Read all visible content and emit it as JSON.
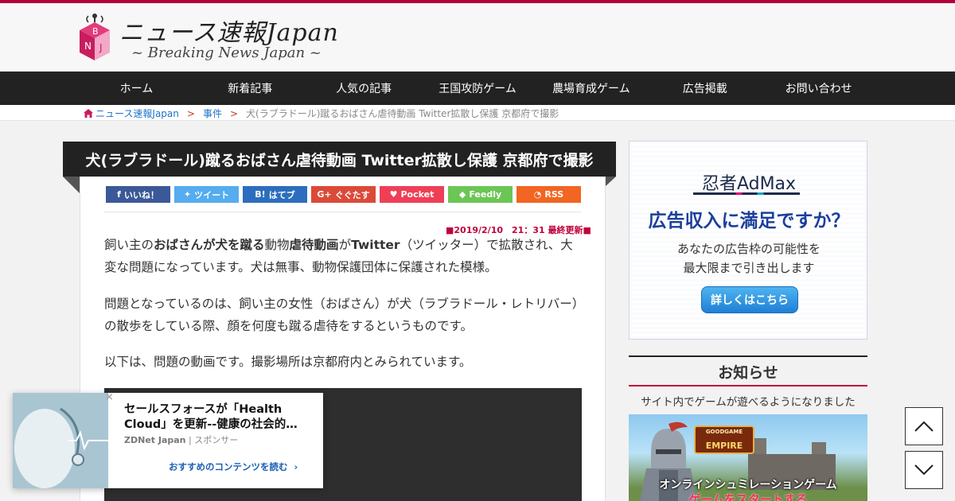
{
  "site": {
    "title": "ニュース速報Japan",
    "subtitle": "~ Breaking News Japan ~",
    "logo_letters": [
      "B",
      "N",
      "J"
    ],
    "brand_color": "#b3003b"
  },
  "nav": {
    "items": [
      {
        "label": "ホーム"
      },
      {
        "label": "新着記事"
      },
      {
        "label": "人気の記事"
      },
      {
        "label": "王国攻防ゲーム"
      },
      {
        "label": "農場育成ゲーム"
      },
      {
        "label": "広告掲載"
      },
      {
        "label": "お問い合わせ"
      }
    ]
  },
  "breadcrumb": {
    "home": "ニュース速報Japan",
    "sep": ">",
    "category": "事件",
    "current": "犬(ラブラドール)蹴るおばさん虐待動画 Twitter拡散し保護 京都府で撮影"
  },
  "article": {
    "title": "犬(ラブラドール)蹴るおばさん虐待動画 Twitter拡散し保護 京都府で撮影",
    "updated": "■2019/2/10　21：31 最終更新■",
    "share": [
      {
        "label": "いいね！",
        "icon": "facebook-icon",
        "glyph": "f",
        "color": "#3b5998"
      },
      {
        "label": "ツイート",
        "icon": "twitter-icon",
        "glyph": "✦",
        "color": "#55acee"
      },
      {
        "label": "はてブ",
        "icon": "hatena-icon",
        "glyph": "B!",
        "color": "#2c6ebd"
      },
      {
        "label": "ぐぐたす",
        "icon": "google-plus-icon",
        "glyph": "G+",
        "color": "#db4a39"
      },
      {
        "label": "Pocket",
        "icon": "pocket-icon",
        "glyph": "♥",
        "color": "#ef3f56"
      },
      {
        "label": "Feedly",
        "icon": "feedly-icon",
        "glyph": "◆",
        "color": "#6cc655"
      },
      {
        "label": "RSS",
        "icon": "rss-icon",
        "glyph": "◔",
        "color": "#f26522"
      }
    ],
    "p1": {
      "a": "飼い主の",
      "b": "おばさんが犬を蹴る",
      "c": "動物",
      "d": "虐待動画",
      "e": "が",
      "f": "Twitter",
      "g": "（ツイッター）で拡散され、大変な問題になっています。犬は無事、動物保護団体に保護された模様。"
    },
    "p2": "問題となっているのは、飼い主の女性（おばさん）が犬（ラブラドール・レトリバー）の散歩をしている際、顔を何度も蹴る虐待をするというものです。",
    "p3": "以下は、問題の動画です。撮影場所は京都府内とみられています。"
  },
  "sidebar": {
    "ad": {
      "logo": "忍者AdMax",
      "headline": "広告収入に満足ですか？",
      "line1": "あなたの広告枠の可能性を",
      "line2": "最大限まで引き出します",
      "button": "詳しくはこちら"
    },
    "notice": {
      "heading": "お知らせ",
      "text": "サイト内でゲームが遊べるようになりました"
    },
    "game_banner": {
      "logo_top": "GOODGAME",
      "logo": "EMPIRE",
      "line1": "オンラインシュミレーションゲーム",
      "line2": "ゲームをスタートする"
    }
  },
  "recommend": {
    "title": "セールスフォースが「Health Cloud」を更新--健康の社会的…",
    "source": "ZDNet Japan",
    "source_sep": "|",
    "sponsor": "スポンサー",
    "cta": "おすすめのコンテンツを読む"
  }
}
